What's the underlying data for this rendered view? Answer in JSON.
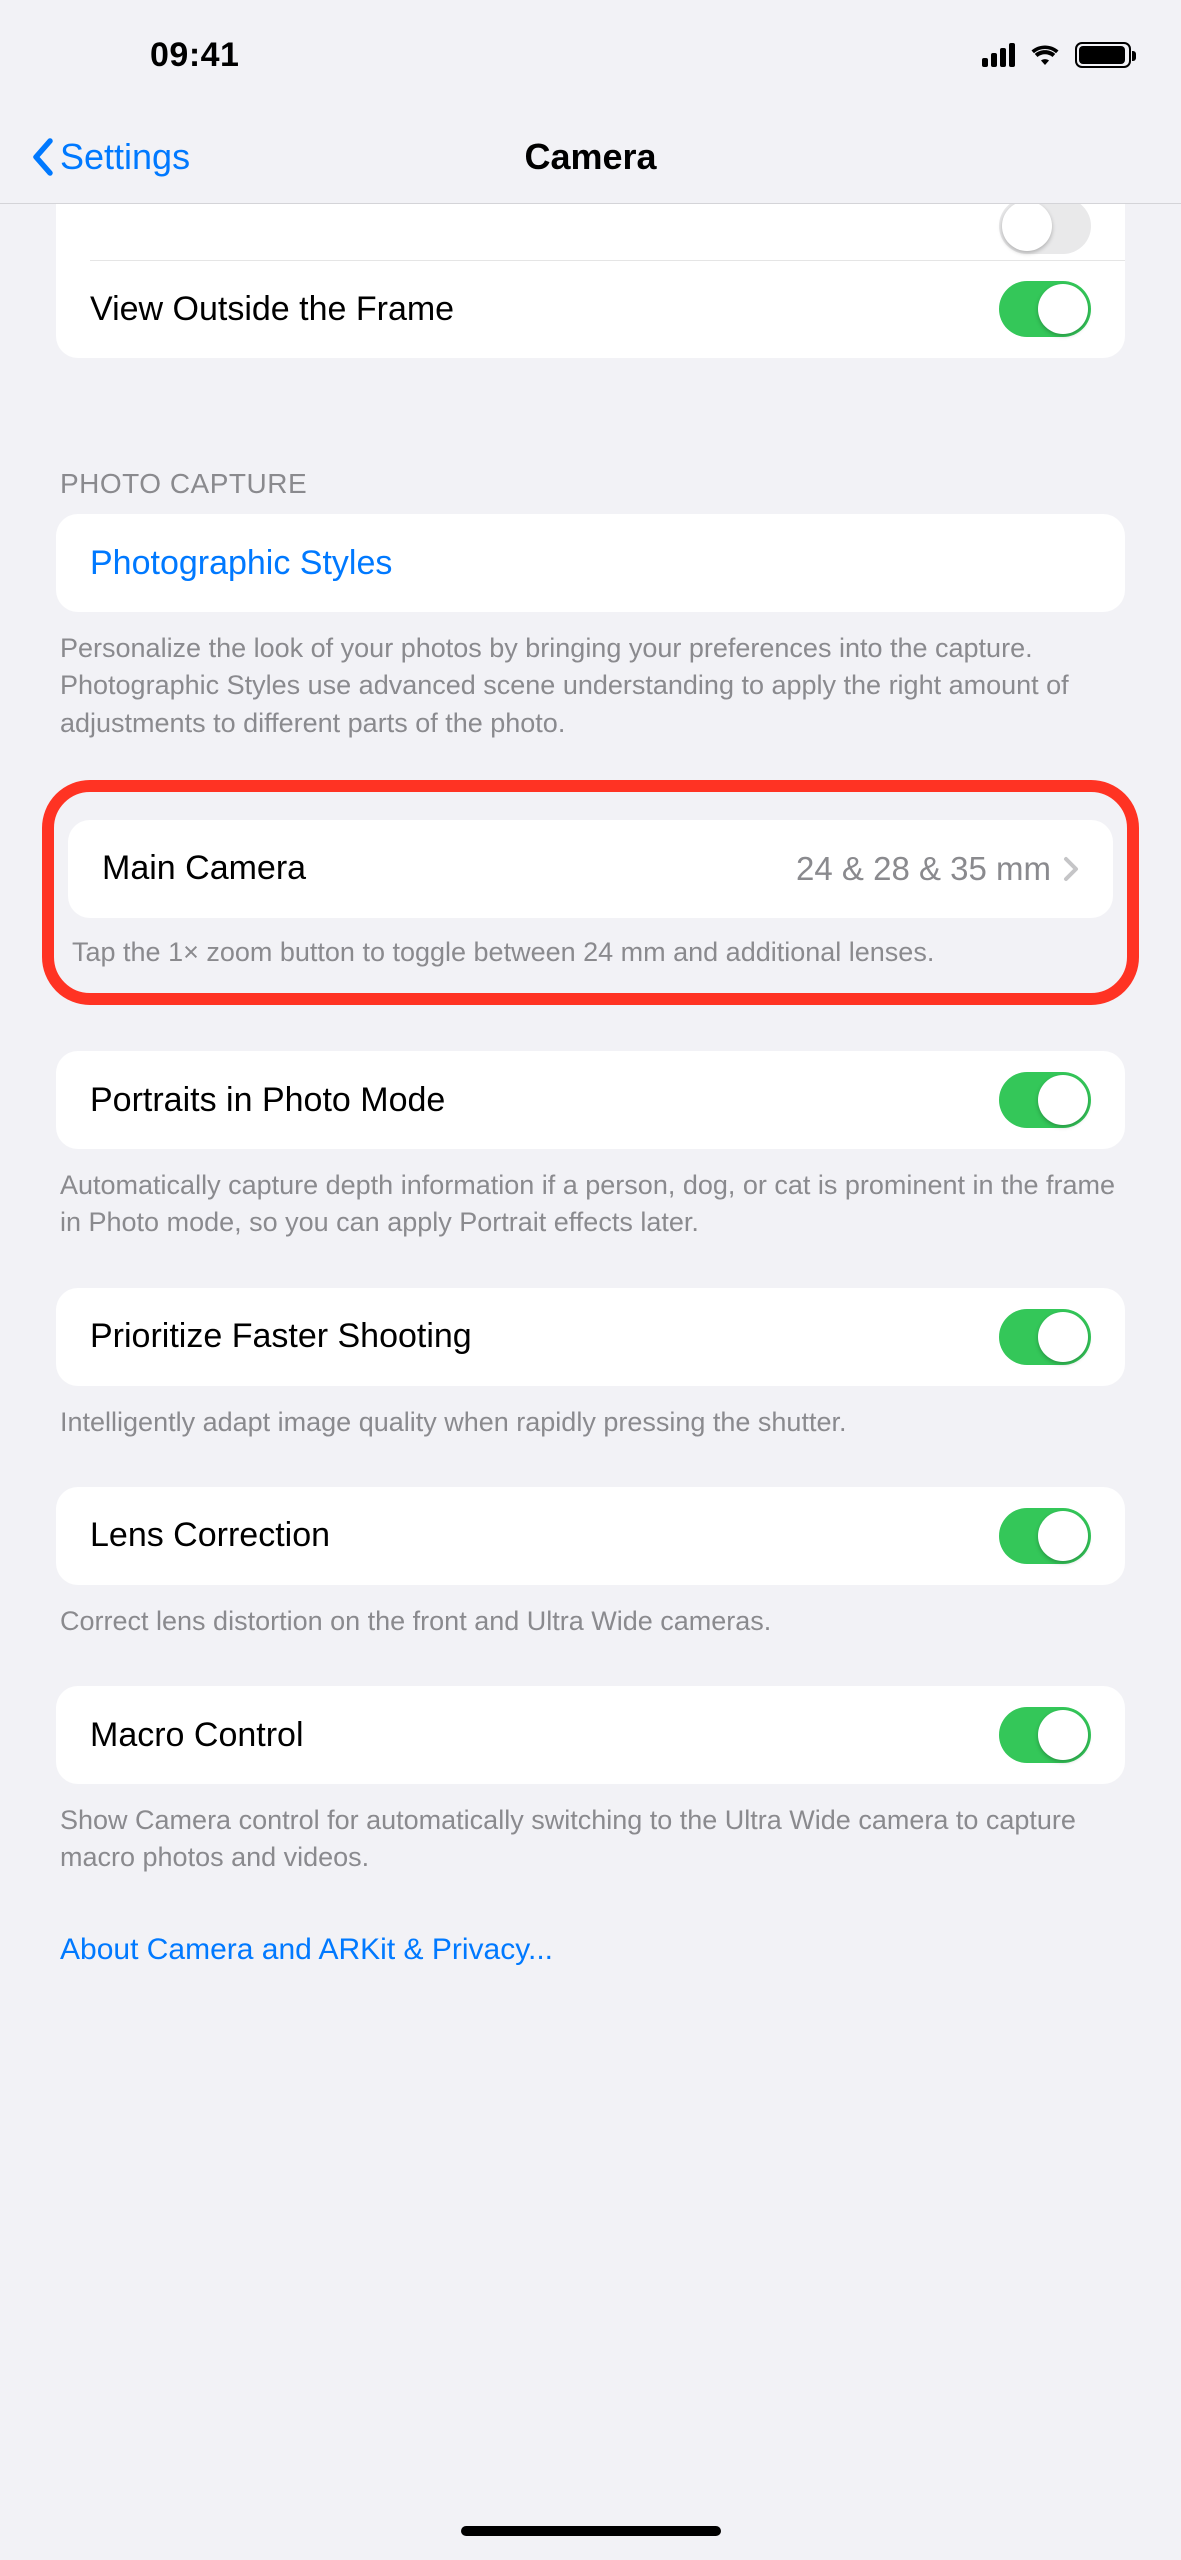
{
  "status": {
    "time": "09:41"
  },
  "nav": {
    "back_label": "Settings",
    "title": "Camera"
  },
  "rows": {
    "view_outside": {
      "label": "View Outside the Frame",
      "on": true
    },
    "section_photo_capture": "PHOTO CAPTURE",
    "photographic_styles": {
      "label": "Photographic Styles"
    },
    "photographic_styles_desc": "Personalize the look of your photos by bringing your preferences into the capture. Photographic Styles use advanced scene understanding to apply the right amount of adjustments to different parts of the photo.",
    "main_camera": {
      "label": "Main Camera",
      "value": "24 & 28 & 35 mm"
    },
    "main_camera_desc": "Tap the 1× zoom button to toggle between 24 mm and additional lenses.",
    "portraits": {
      "label": "Portraits in Photo Mode",
      "on": true
    },
    "portraits_desc": "Automatically capture depth information if a person, dog, or cat is prominent in the frame in Photo mode, so you can apply Portrait effects later.",
    "prioritize": {
      "label": "Prioritize Faster Shooting",
      "on": true
    },
    "prioritize_desc": "Intelligently adapt image quality when rapidly pressing the shutter.",
    "lens_correction": {
      "label": "Lens Correction",
      "on": true
    },
    "lens_correction_desc": "Correct lens distortion on the front and Ultra Wide cameras.",
    "macro": {
      "label": "Macro Control",
      "on": true
    },
    "macro_desc": "Show Camera control for automatically switching to the Ultra Wide camera to capture macro photos and videos.",
    "about_link": "About Camera and ARKit & Privacy..."
  }
}
